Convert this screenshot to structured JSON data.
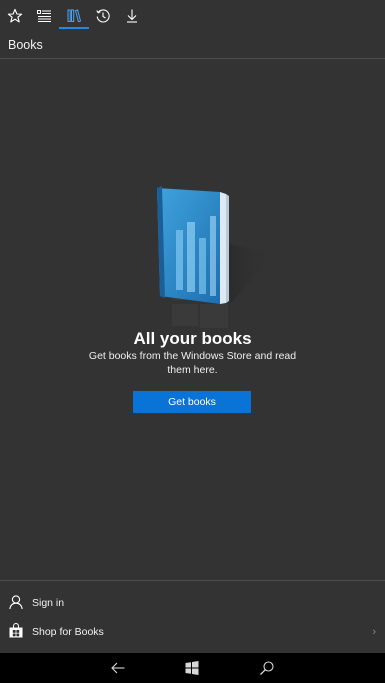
{
  "tabs": [
    {
      "id": "favorites",
      "icon": "star-icon"
    },
    {
      "id": "reading-list",
      "icon": "reading-list-icon"
    },
    {
      "id": "books",
      "icon": "books-icon",
      "active": true
    },
    {
      "id": "history",
      "icon": "history-icon"
    },
    {
      "id": "downloads",
      "icon": "download-icon"
    }
  ],
  "colors": {
    "background": "#333333",
    "accent": "#1f8ae6",
    "button": "#0a73d8",
    "navbar": "#000000"
  },
  "section": {
    "title": "Books"
  },
  "empty_state": {
    "illustration": "blue-book-illustration",
    "title": "All your books",
    "description": "Get books from the Windows Store and read them here.",
    "button_label": "Get books"
  },
  "actions": {
    "sign_in": {
      "label": "Sign in",
      "icon": "person-icon"
    },
    "shop": {
      "label": "Shop for Books",
      "icon": "store-icon",
      "chevron": "›"
    }
  },
  "navbar": {
    "icons": [
      "back-arrow-icon",
      "windows-logo-icon",
      "search-icon"
    ]
  }
}
